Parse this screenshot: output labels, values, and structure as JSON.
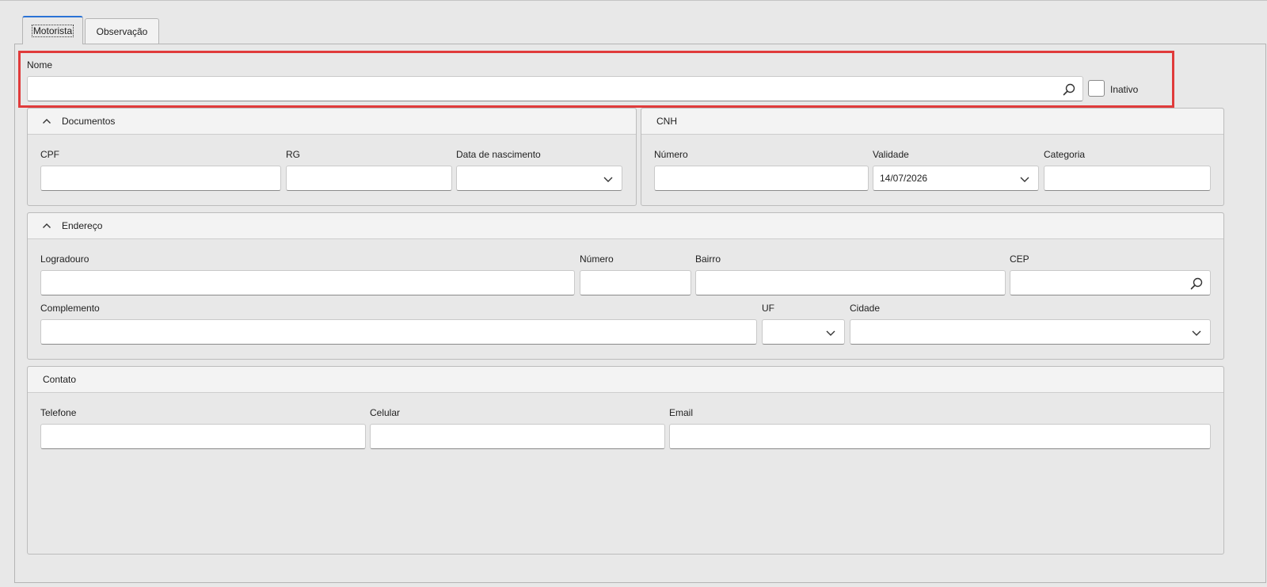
{
  "tabs": [
    {
      "label": "Motorista",
      "active": true
    },
    {
      "label": "Observação",
      "active": false
    }
  ],
  "nome": {
    "label": "Nome",
    "value": "",
    "search_icon": "search-icon"
  },
  "inativo": {
    "label": "Inativo",
    "checked": false
  },
  "documentos": {
    "title": "Documentos",
    "cpf": {
      "label": "CPF",
      "value": ""
    },
    "rg": {
      "label": "RG",
      "value": ""
    },
    "data_nascimento": {
      "label": "Data de nascimento",
      "value": ""
    }
  },
  "cnh": {
    "title": "CNH",
    "numero": {
      "label": "Número",
      "value": ""
    },
    "validade": {
      "label": "Validade",
      "value": "14/07/2026"
    },
    "categoria": {
      "label": "Categoria",
      "value": ""
    }
  },
  "endereco": {
    "title": "Endereço",
    "logradouro": {
      "label": "Logradouro",
      "value": ""
    },
    "numero": {
      "label": "Número",
      "value": ""
    },
    "bairro": {
      "label": "Bairro",
      "value": ""
    },
    "cep": {
      "label": "CEP",
      "value": ""
    },
    "complemento": {
      "label": "Complemento",
      "value": ""
    },
    "uf": {
      "label": "UF",
      "value": ""
    },
    "cidade": {
      "label": "Cidade",
      "value": ""
    }
  },
  "contato": {
    "title": "Contato",
    "telefone": {
      "label": "Telefone",
      "value": ""
    },
    "celular": {
      "label": "Celular",
      "value": ""
    },
    "email": {
      "label": "Email",
      "value": ""
    }
  },
  "colors": {
    "accent": "#2b73d6",
    "highlight": "#e03b3b"
  }
}
